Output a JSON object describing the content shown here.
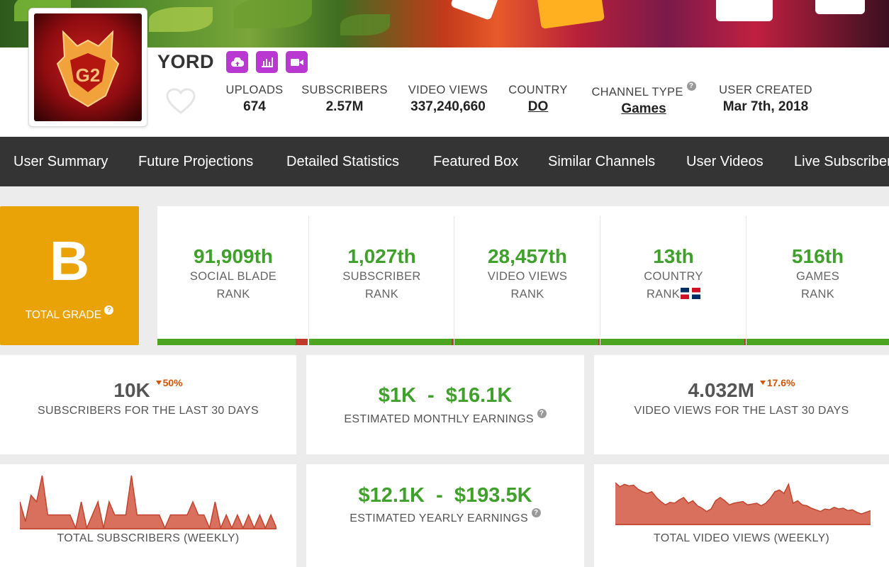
{
  "channel": {
    "name": "YORD"
  },
  "header_icons": [
    "upload-icon",
    "bar-chart-icon",
    "video-icon"
  ],
  "stats": [
    {
      "label": "UPLOADS",
      "value": "674"
    },
    {
      "label": "SUBSCRIBERS",
      "value": "2.57M"
    },
    {
      "label": "VIDEO VIEWS",
      "value": "337,240,660"
    },
    {
      "label": "COUNTRY",
      "value": "DO"
    },
    {
      "label": "CHANNEL TYPE",
      "value": "Games"
    },
    {
      "label": "USER CREATED",
      "value": "Mar 7th, 2018"
    }
  ],
  "nav": [
    "User Summary",
    "Future Projections",
    "Detailed Statistics",
    "Featured Box",
    "Similar Channels",
    "User Videos",
    "Live Subscriber"
  ],
  "grade": {
    "letter": "B",
    "label": "TOTAL GRADE"
  },
  "ranks": [
    {
      "value": "91,909th",
      "line1": "SOCIAL BLADE",
      "line2": "RANK"
    },
    {
      "value": "1,027th",
      "line1": "SUBSCRIBER",
      "line2": "RANK"
    },
    {
      "value": "28,457th",
      "line1": "VIDEO VIEWS",
      "line2": "RANK"
    },
    {
      "value": "13th",
      "line1": "COUNTRY",
      "line2": "RANK"
    },
    {
      "value": "516th",
      "line1": "GAMES",
      "line2": "RANK"
    }
  ],
  "cards": {
    "subs30": {
      "value": "10K",
      "delta": "50%",
      "label": "SUBSCRIBERS FOR THE LAST 30 DAYS"
    },
    "monthly": {
      "value": "$1K  -  $16.1K",
      "label": "ESTIMATED MONTHLY EARNINGS"
    },
    "views30": {
      "value": "4.032M",
      "delta": "17.6%",
      "label": "VIDEO VIEWS FOR THE LAST 30 DAYS"
    },
    "yearly": {
      "value": "$12.1K  -  $193.5K",
      "label": "ESTIMATED YEARLY EARNINGS"
    },
    "subs_chart_label": "TOTAL SUBSCRIBERS (WEEKLY)",
    "views_chart_label": "TOTAL VIDEO VIEWS (WEEKLY)"
  },
  "colors": {
    "accent_green": "#3fa12b",
    "grade_bg": "#e9a306",
    "nav_bg": "#343434",
    "icon_purple": "#b838d1",
    "sparkline": "#d9705e",
    "delta_red": "#d35400"
  },
  "chart_data": [
    {
      "type": "area",
      "title": "TOTAL SUBSCRIBERS (WEEKLY)",
      "values": [
        2,
        0.5,
        2.5,
        2,
        4,
        1,
        1,
        1,
        1,
        1,
        0,
        2,
        0,
        1,
        2,
        0,
        2,
        1,
        1,
        1,
        4,
        1,
        1,
        1,
        1,
        1,
        0,
        1,
        1,
        1,
        1,
        2,
        1,
        1,
        0,
        2,
        0,
        1,
        0,
        1,
        0,
        1,
        0,
        1,
        0,
        1,
        0
      ]
    },
    {
      "type": "area",
      "title": "TOTAL VIDEO VIEWS (WEEKLY)",
      "values": [
        5,
        4.5,
        4.8,
        4.6,
        4.7,
        4.2,
        3.9,
        3.7,
        3.9,
        3.2,
        2.7,
        2.3,
        2.6,
        2.5,
        2.9,
        3.2,
        2.5,
        2.8,
        2.2,
        1.9,
        1.5,
        1.8,
        2.8,
        3.2,
        2.8,
        2.3,
        2.5,
        2.6,
        2.7,
        2.3,
        2.4,
        2.5,
        2.2,
        2.5,
        3.1,
        3.9,
        4.1,
        3.7,
        4.8,
        2.5,
        2.8,
        2.3,
        2.2,
        1.9,
        1.7,
        1.5,
        1.8,
        1.7,
        2.0,
        1.8,
        1.9,
        1.6,
        1.7,
        1.4,
        1.2,
        1.4,
        1.6
      ]
    }
  ]
}
